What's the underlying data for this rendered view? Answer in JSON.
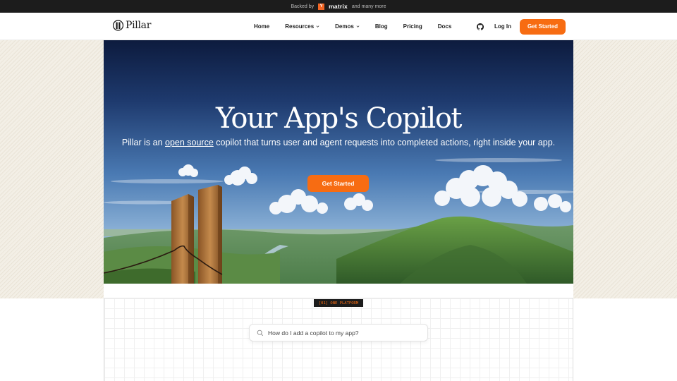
{
  "announcement": {
    "backed_by": "Backed by",
    "yc_badge": "Y",
    "partner": "matrix",
    "more": "and many more"
  },
  "header": {
    "logo_text": "Pillar",
    "nav": [
      {
        "label": "Home",
        "dropdown": false
      },
      {
        "label": "Resources",
        "dropdown": true
      },
      {
        "label": "Demos",
        "dropdown": true
      },
      {
        "label": "Blog",
        "dropdown": false
      },
      {
        "label": "Pricing",
        "dropdown": false
      },
      {
        "label": "Docs",
        "dropdown": false
      }
    ],
    "github_icon": "github-icon",
    "login_label": "Log In",
    "cta_label": "Get Started"
  },
  "hero": {
    "title": "Your App's Copilot",
    "subtitle_pre": "Pillar is an ",
    "subtitle_link": "open source",
    "subtitle_post": " copilot that turns user and agent requests into completed actions, right inside your app.",
    "cta_label": "Get Started"
  },
  "section": {
    "tag": "[01] ONE PLATFORM",
    "search_placeholder": "How do I add a copilot to my app?"
  },
  "colors": {
    "accent": "#f76c12",
    "topbar": "#1c1c1c",
    "sky_top": "#0f1f44",
    "sky_mid": "#3a6aa8"
  }
}
